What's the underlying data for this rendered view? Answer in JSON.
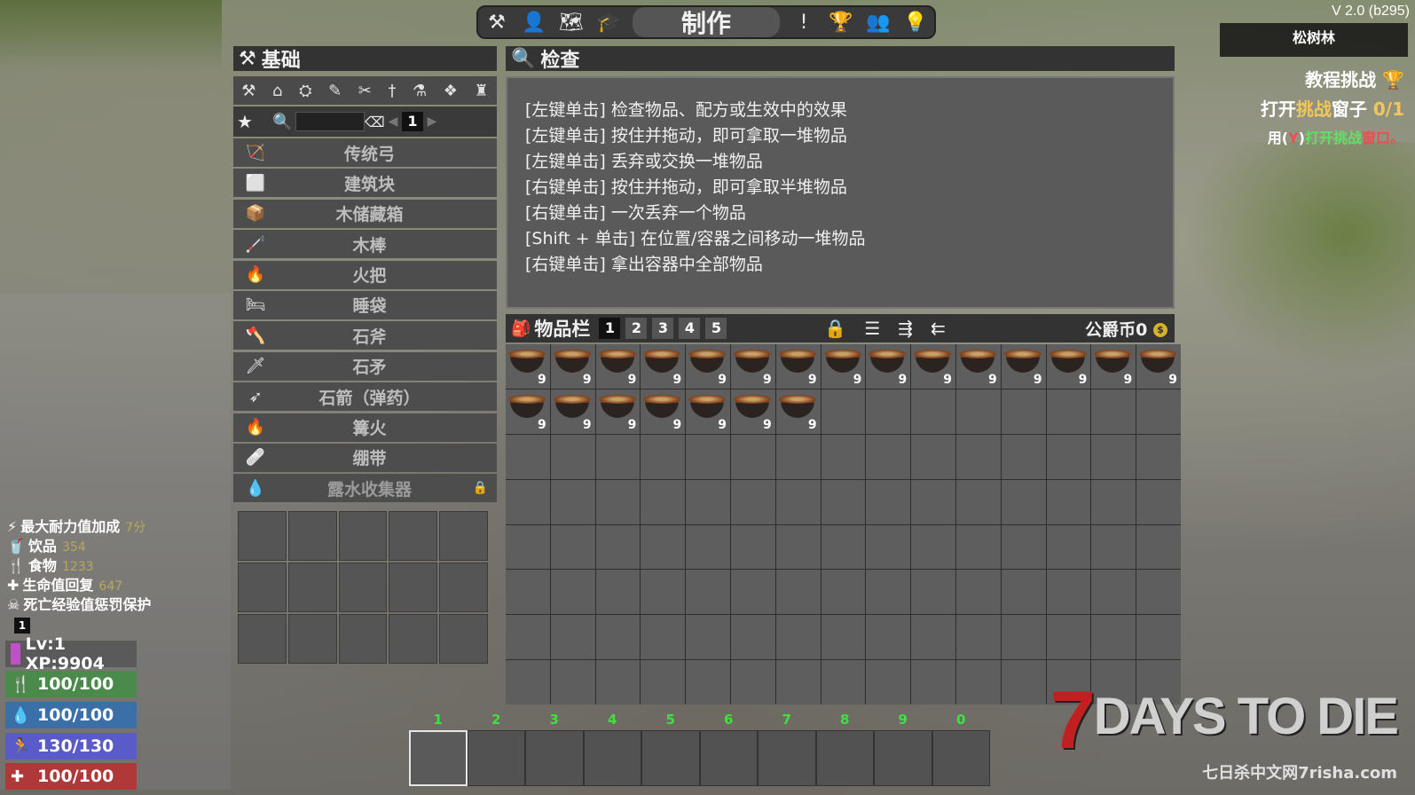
{
  "version": "V 2.0 (b295)",
  "biome": "松树林",
  "challenge": {
    "title": "教程挑战",
    "open_prefix": "打开",
    "open_hl": "挑战",
    "open_mid": "窗子",
    "open_count": "0/1",
    "hint_prefix": "用(",
    "hint_key": "Y",
    "hint_mid": ")",
    "hint_action": "打开挑战",
    "hint_suffix": "窗口。"
  },
  "topbar": {
    "title": "制作",
    "left_icons": [
      "hammer-icon",
      "character-icon",
      "map-icon",
      "skills-icon"
    ],
    "right_icons": [
      "quest-icon",
      "trophy-icon",
      "players-icon",
      "tips-icon"
    ]
  },
  "crafting": {
    "header": "基础",
    "page": "1",
    "categories": [
      "hammer-icon",
      "building-icon",
      "workstation-icon",
      "tool-icon",
      "tools-icon",
      "weapon-icon",
      "medical-icon",
      "armor-icon",
      "decor-icon"
    ],
    "recipes": [
      {
        "name": "传统弓",
        "icon": "🏹"
      },
      {
        "name": "建筑块",
        "icon": "⬜"
      },
      {
        "name": "木储藏箱",
        "icon": "📦"
      },
      {
        "name": "木棒",
        "icon": "🦯"
      },
      {
        "name": "火把",
        "icon": "🔥"
      },
      {
        "name": "睡袋",
        "icon": "🛏"
      },
      {
        "name": "石斧",
        "icon": "🪓"
      },
      {
        "name": "石矛",
        "icon": "🗡"
      },
      {
        "name": "石箭（弹药）",
        "icon": "➶"
      },
      {
        "name": "篝火",
        "icon": "🔥"
      },
      {
        "name": "绷带",
        "icon": "🩹"
      },
      {
        "name": "露水收集器",
        "icon": "💧"
      }
    ]
  },
  "inspect": {
    "header": "检查",
    "lines": [
      "[左键单击] 检查物品、配方或生效中的效果",
      "[左键单击] 按住并拖动，即可拿取一堆物品",
      "[左键单击] 丢弃或交换一堆物品",
      "[右键单击] 按住并拖动，即可拿取半堆物品",
      "[右键单击] 一次丢弃一个物品",
      "[Shift + 单击] 在位置/容器之间移动一堆物品",
      "[右键单击] 拿出容器中全部物品"
    ]
  },
  "inventory": {
    "header": "物品栏",
    "tabs": [
      "1",
      "2",
      "3",
      "4",
      "5"
    ],
    "coins_label": "公爵币",
    "coins": "0",
    "stack_count": "9",
    "filled_slots": 22
  },
  "buffs": [
    {
      "label": "最大耐力值加成",
      "value": "7分",
      "icon": "⚡"
    },
    {
      "label": "饮品",
      "value": "354",
      "icon": "🥤"
    },
    {
      "label": "食物",
      "value": "1233",
      "icon": "🍴"
    },
    {
      "label": "生命值回复",
      "value": "647",
      "icon": "✚"
    },
    {
      "label": "死亡经验值惩罚保护",
      "value": "",
      "icon": "☠"
    }
  ],
  "buff_page": "1",
  "stats": {
    "level": "Lv:1 XP:9904",
    "food": "100/100",
    "water": "100/100",
    "stamina": "130/130",
    "health": "100/100"
  },
  "hotbar": {
    "numbers": [
      "1",
      "2",
      "3",
      "4",
      "5",
      "6",
      "7",
      "8",
      "9",
      "0"
    ]
  },
  "logo": {
    "seven": "7",
    "text": "DAYS TO DIE",
    "sub": "七日杀中文网7risha.com"
  }
}
